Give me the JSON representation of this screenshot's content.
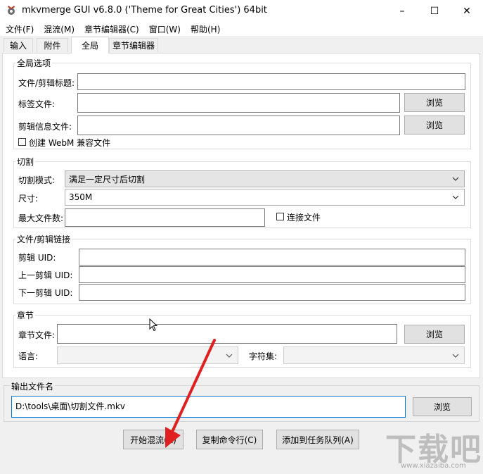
{
  "window": {
    "title": "mkvmerge GUI v6.8.0 ('Theme for Great Cities') 64bit",
    "minimize": "–",
    "maximize": "☐",
    "close": "✕"
  },
  "menu": [
    "文件(F)",
    "混流(M)",
    "章节编辑器(C)",
    "窗口(W)",
    "帮助(H)"
  ],
  "tabs": [
    "输入",
    "附件",
    "全局",
    "章节编辑器"
  ],
  "active_tab": "全局",
  "global_options": {
    "title": "全局选项",
    "segment_title_label": "文件/剪辑标题:",
    "segment_title_value": "",
    "tags_file_label": "标签文件:",
    "tags_file_value": "",
    "segment_info_label": "剪辑信息文件:",
    "segment_info_value": "",
    "browse_label": "浏览",
    "webm_label": "创建 WebM 兼容文件",
    "webm_checked": false
  },
  "split": {
    "title": "切割",
    "mode_label": "切割模式:",
    "mode_value": "满足一定尺寸后切割",
    "size_label": "尺寸:",
    "size_value": "350M",
    "max_files_label": "最大文件数:",
    "max_files_value": "",
    "link_files_label": "连接文件",
    "link_files_checked": false
  },
  "linking": {
    "title": "文件/剪辑链接",
    "segment_uid_label": "剪辑 UID:",
    "prev_uid_label": "上一剪辑 UID:",
    "next_uid_label": "下一剪辑 UID:"
  },
  "chapters": {
    "title": "章节",
    "file_label": "章节文件:",
    "file_value": "",
    "browse_label": "浏览",
    "language_label": "语言:",
    "charset_label": "字符集:"
  },
  "output": {
    "title": "输出文件名",
    "value": "D:\\tools\\桌面\\切割文件.mkv",
    "browse_label": "浏览"
  },
  "actions": {
    "start_mux": "开始混流(R)",
    "copy_cmdline": "复制命令行(C)",
    "add_to_queue": "添加到任务队列(A)"
  },
  "watermark": {
    "text": "下载吧",
    "url": "www.xiazaiba.com"
  }
}
